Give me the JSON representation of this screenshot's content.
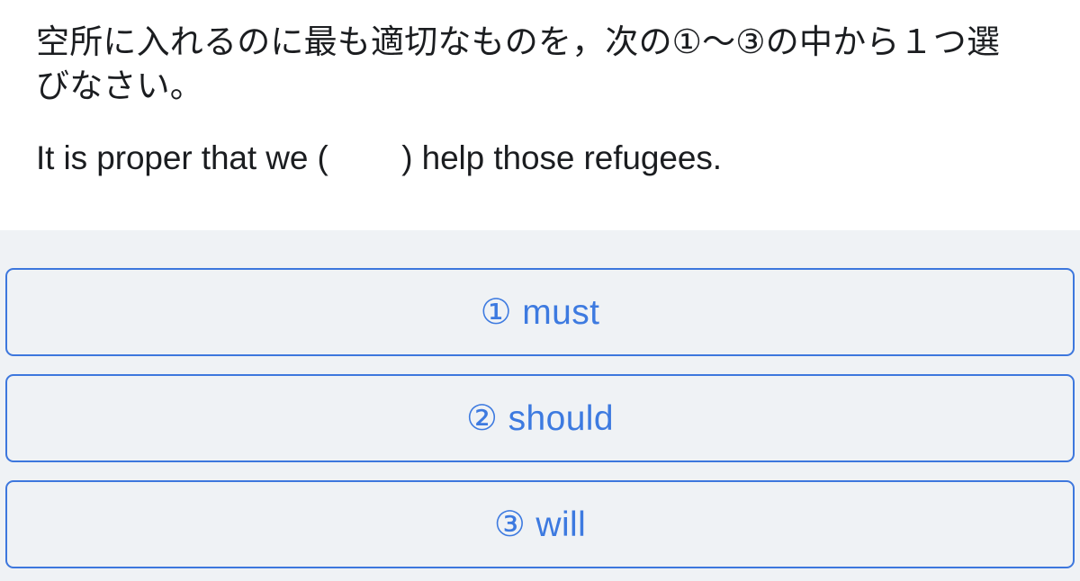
{
  "question": {
    "instruction": "空所に入れるのに最も適切なものを，次の①〜③の中から１つ選びなさい。",
    "sentence": "It is proper that we (        ) help those refugees."
  },
  "options": {
    "items": [
      {
        "marker": "①",
        "text": "must",
        "label": "① must"
      },
      {
        "marker": "②",
        "text": "should",
        "label": "② should"
      },
      {
        "marker": "③",
        "text": "will",
        "label": "③ will"
      }
    ]
  },
  "colors": {
    "question_background": "#ffffff",
    "options_background": "#eff2f5",
    "option_border": "#3d77dd",
    "option_text": "#3d7ae0",
    "question_text": "#1b1d20"
  }
}
